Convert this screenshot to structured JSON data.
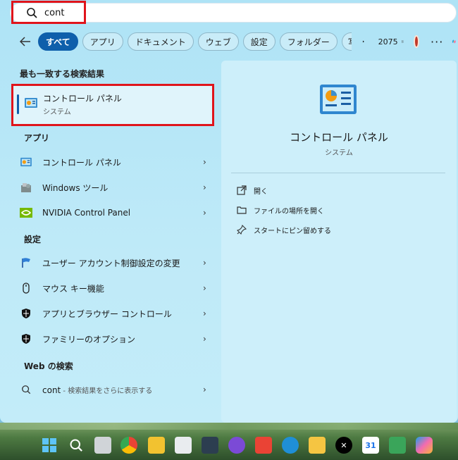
{
  "search": {
    "value": "cont"
  },
  "filters": {
    "chips": [
      "すべて",
      "アプリ",
      "ドキュメント",
      "ウェブ",
      "設定",
      "フォルダー",
      "写"
    ],
    "points": "2075"
  },
  "best_match": {
    "heading": "最も一致する検索結果",
    "title": "コントロール パネル",
    "subtitle": "システム"
  },
  "apps": {
    "heading": "アプリ",
    "items": [
      "コントロール パネル",
      "Windows ツール",
      "NVIDIA Control Panel"
    ]
  },
  "settings": {
    "heading": "設定",
    "items": [
      "ユーザー アカウント制御設定の変更",
      "マウス キー機能",
      "アプリとブラウザー コントロール",
      "ファミリーのオプション"
    ]
  },
  "web": {
    "heading": "Web の検索",
    "query": "cont",
    "suffix": " - 検索結果をさらに表示する"
  },
  "preview": {
    "title": "コントロール パネル",
    "subtitle": "システム",
    "actions": [
      "開く",
      "ファイルの場所を開く",
      "スタートにピン留めする"
    ]
  },
  "taskbar": {
    "calendar_day": "31"
  },
  "colors": {
    "accent": "#0f5fab",
    "highlight_box": "#e0141b"
  }
}
